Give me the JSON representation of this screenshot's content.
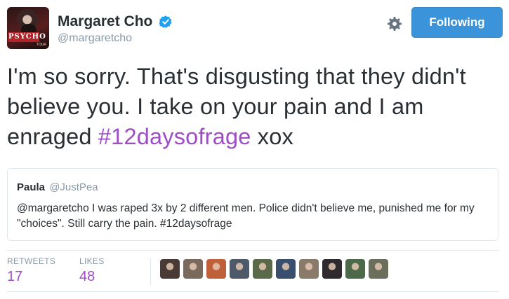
{
  "author": {
    "display_name": "Margaret Cho",
    "handle": "@margaretcho",
    "avatar_logo": "PSYCHO",
    "avatar_sub": "TOUR",
    "verified_icon": "verified-badge-icon"
  },
  "actions": {
    "settings_icon": "gear-icon",
    "follow_label": "Following"
  },
  "tweet": {
    "text_plain": "I'm so sorry. That's disgusting that they didn't believe you. I take on your pain and I am enraged ",
    "hashtag": "#12daysofrage",
    "text_after": " xox"
  },
  "quoted_tweet": {
    "name": "Paula",
    "handle": "@JustPea",
    "text": "@margaretcho I was raped 3x by 2 different men. Police didn't believe me, punished me for my \"choices\". Still carry the pain. #12daysofrage"
  },
  "stats": {
    "retweets_label": "RETWEETS",
    "retweets_value": "17",
    "likes_label": "LIKES",
    "likes_value": "48"
  },
  "colors": {
    "accent": "#9e4ec5",
    "follow_button": "#3b94d9",
    "muted": "#8899a6",
    "border": "#e1e8ed"
  },
  "likers": [
    {
      "name": "liker-avatar-1",
      "color": "#4a3a36"
    },
    {
      "name": "liker-avatar-2",
      "color": "#7a6a5e"
    },
    {
      "name": "liker-avatar-3",
      "color": "#c0603a"
    },
    {
      "name": "liker-avatar-4",
      "color": "#4e5a6a"
    },
    {
      "name": "liker-avatar-5",
      "color": "#5a6a48"
    },
    {
      "name": "liker-avatar-6",
      "color": "#3a4e6e"
    },
    {
      "name": "liker-avatar-7",
      "color": "#8a7a6a"
    },
    {
      "name": "liker-avatar-8",
      "color": "#2e2a2e"
    },
    {
      "name": "liker-avatar-9",
      "color": "#4c6a4a"
    },
    {
      "name": "liker-avatar-10",
      "color": "#6a6e5a"
    }
  ]
}
